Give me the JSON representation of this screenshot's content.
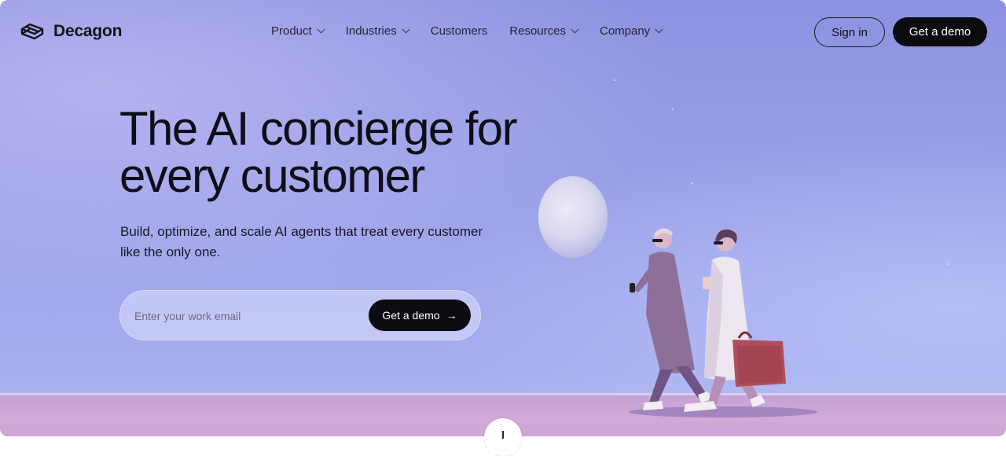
{
  "brand": {
    "name": "Decagon"
  },
  "nav": {
    "items": [
      {
        "label": "Product",
        "has_dropdown": true
      },
      {
        "label": "Industries",
        "has_dropdown": true
      },
      {
        "label": "Customers",
        "has_dropdown": false
      },
      {
        "label": "Resources",
        "has_dropdown": true
      },
      {
        "label": "Company",
        "has_dropdown": true
      }
    ],
    "sign_in_label": "Sign in",
    "demo_label": "Get a demo"
  },
  "hero": {
    "headline_line1": "The AI concierge for",
    "headline_line2": "every customer",
    "subtext": "Build, optimize, and scale AI agents that treat every customer like the only one.",
    "email_placeholder": "Enter your work email",
    "cta_label": "Get a demo",
    "cta_icon": "arrow-right-icon"
  },
  "colors": {
    "sky": "#9aa0e8",
    "ground": "#cfa8d6",
    "button_dark": "#0b0b10",
    "text_dark": "#0e0e18"
  }
}
